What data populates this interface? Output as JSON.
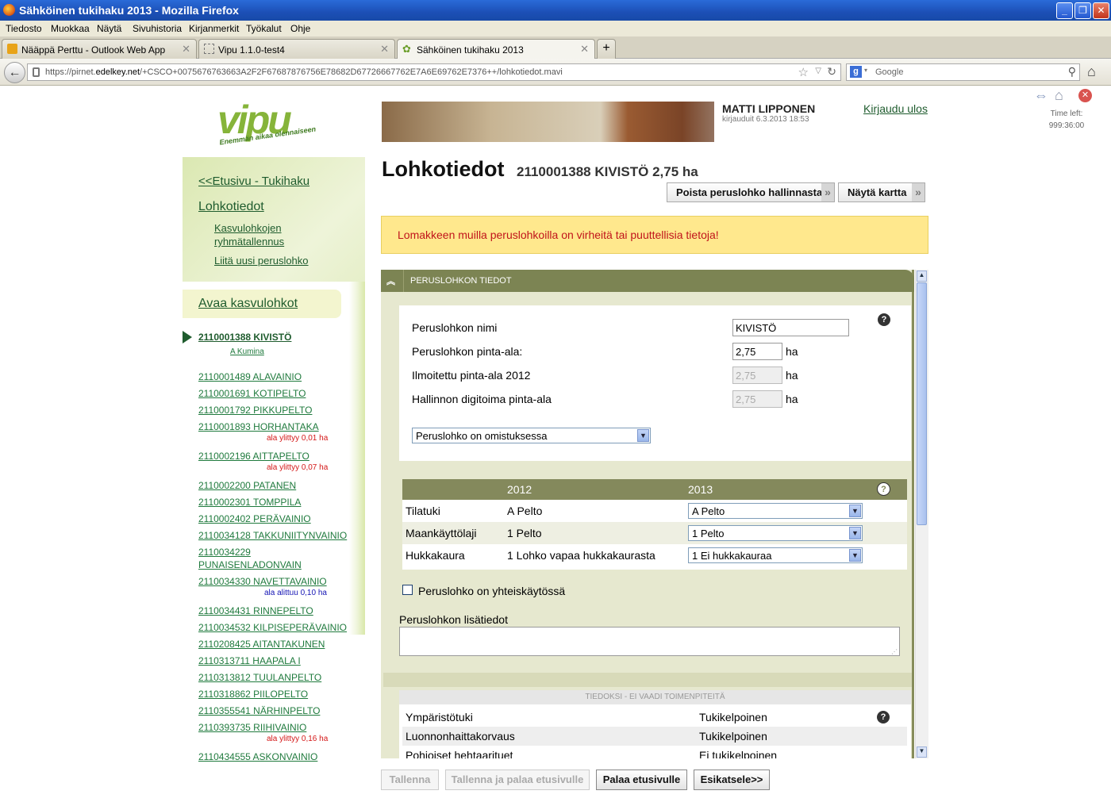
{
  "window": {
    "title": "Sähköinen tukihaku 2013 - Mozilla Firefox"
  },
  "menu": [
    "Tiedosto",
    "Muokkaa",
    "Näytä",
    "Sivuhistoria",
    "Kirjanmerkit",
    "Työkalut",
    "Ohje"
  ],
  "tabs": [
    {
      "label": "Nääppä Perttu - Outlook Web App"
    },
    {
      "label": "Vipu 1.1.0-test4"
    },
    {
      "label": "Sähköinen tukihaku 2013"
    }
  ],
  "url": {
    "prefix": "https://pirnet.",
    "domain": "edelkey.net",
    "rest": "/+CSCO+0075676763663A2F2F67687876756E78682D67726667762E7A6E69762E7376++/lohkotiedot.mavi"
  },
  "search": {
    "placeholder": "Google"
  },
  "logo": {
    "text": "vipu",
    "slogan": "Enemmän aikaa olennaiseen"
  },
  "user": {
    "name": "MATTI LIPPONEN",
    "login_info": "kirjauduit 6.3.2013 18:53",
    "logout": "Kirjaudu ulos"
  },
  "timer": {
    "label": "Time left:",
    "value": "999:36:00"
  },
  "sidebar": {
    "front": "<<Etusivu - Tukihaku",
    "lohkotiedot": "Lohkotiedot",
    "group_save": [
      "Kasvulohkojen",
      "ryhmätallennus"
    ],
    "attach_new": "Liitä uusi peruslohko",
    "open_growth": "Avaa kasvulohkot",
    "current": {
      "label": "2110001388 KIVISTÖ",
      "sub": "A Kumina"
    },
    "items": [
      {
        "label": "2110001489 ALAVAINIO"
      },
      {
        "label": "2110001691 KOTIPELTO"
      },
      {
        "label": "2110001792 PIKKUPELTO"
      },
      {
        "label": "2110001893 HORHANTAKA",
        "note": "ala ylittyy 0,01 ha"
      },
      {
        "label": "2110002196 AITTAPELTO",
        "note": "ala ylittyy 0,07 ha"
      },
      {
        "label": "2110002200 PATANEN"
      },
      {
        "label": "2110002301 TOMPPILA"
      },
      {
        "label": "2110002402 PERÄVAINIO"
      },
      {
        "label": "2110034128 TAKKUNIITYNVAINIO"
      },
      {
        "label": "2110034229",
        "label2": "PUNAISENLADONVAIN"
      },
      {
        "label": "2110034330 NAVETTAVAINIO",
        "note": "ala alittuu 0,10 ha"
      },
      {
        "label": "2110034431 RINNEPELTO"
      },
      {
        "label": "2110034532 KILPISEPERÄVAINIO"
      },
      {
        "label": "2110208425 AITANTAKUNEN"
      },
      {
        "label": "2110313711 HAAPALA I"
      },
      {
        "label": "2110313812 TUULANPELTO"
      },
      {
        "label": "2110318862 PIILOPELTO"
      },
      {
        "label": "2110355541 NÄRHINPELTO"
      },
      {
        "label": "2110393735 RIIHIVAINIO",
        "note": "ala ylittyy 0,16 ha"
      },
      {
        "label": "2110434555 ASKONVAINIO"
      }
    ],
    "colors": {
      "over": "#d41717",
      "under": "#1414b4"
    }
  },
  "main": {
    "title": "Lohkotiedot",
    "subtitle": "2110001388 KIVISTÖ 2,75 ha",
    "remove_button": "Poista peruslohko hallinnasta",
    "map_button": "Näytä kartta",
    "warning": "Lomakkeen muilla peruslohkoilla on virheitä tai puuttellisia tietoja!",
    "panel_title": "PERUSLOHKON TIEDOT",
    "fields": {
      "name_label": "Peruslohkon nimi",
      "name_value": "KIVISTÖ",
      "area_label": "Peruslohkon pinta-ala:",
      "area_value": "2,75",
      "reported_label": "Ilmoitettu pinta-ala 2012",
      "reported_value": "2,75",
      "digitized_label": "Hallinnon digitoima pinta-ala",
      "digitized_value": "2,75",
      "unit": "ha",
      "ownership": "Peruslohko on omistuksessa"
    },
    "table": {
      "headers": [
        "",
        "2012",
        "2013"
      ],
      "rows": [
        {
          "label": "Tilatuki",
          "y2012": "A Pelto",
          "y2013": "A Pelto"
        },
        {
          "label": "Maankäyttölaji",
          "y2012": "1 Pelto",
          "y2013": "1 Pelto"
        },
        {
          "label": "Hukkakaura",
          "y2012": "1 Lohko vapaa hukkakaurasta",
          "y2013": "1 Ei hukkakauraa"
        }
      ]
    },
    "shared_use": "Peruslohko on yhteiskäytössä",
    "extra_info_label": "Peruslohkon lisätiedot",
    "info_header": "TIEDOKSI - EI VAADI TOIMENPITEITÄ",
    "info_rows": [
      {
        "label": "Ympäristötuki",
        "value": "Tukikelpoinen"
      },
      {
        "label": "Luonnonhaittakorvaus",
        "value": "Tukikelpoinen"
      },
      {
        "label": "Pohjoiset hehtaarituet",
        "value": "Ei tukikelpoinen"
      }
    ]
  },
  "footer": {
    "save": "Tallenna",
    "save_return": "Tallenna ja palaa etusivulle",
    "return": "Palaa etusivulle",
    "preview": "Esikatsele>>"
  }
}
